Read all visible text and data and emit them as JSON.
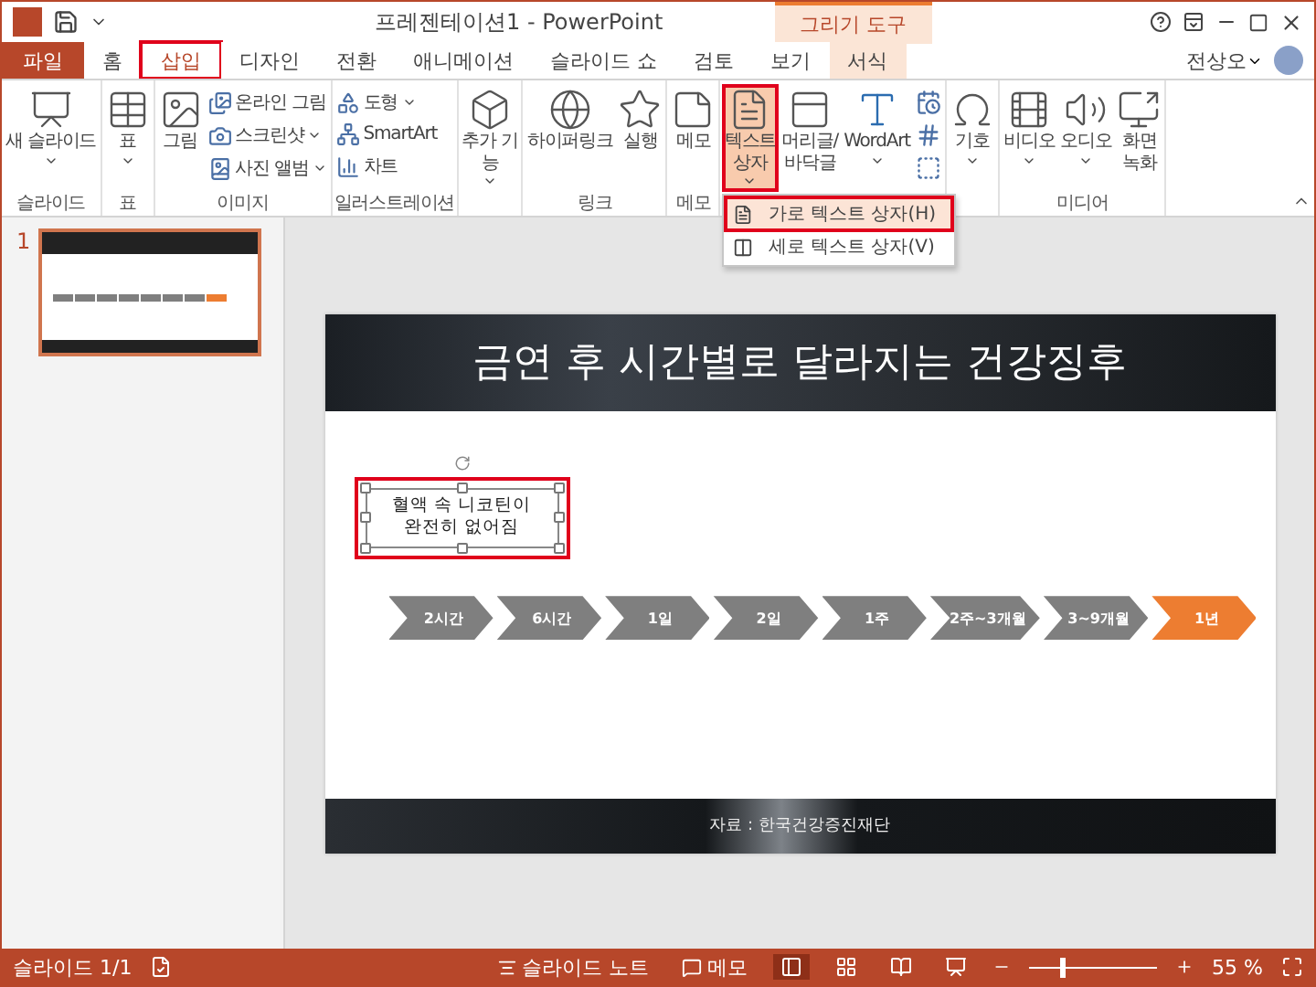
{
  "window": {
    "title": "프레젠테이션1 - PowerPoint",
    "contextual_group": "그리기 도구"
  },
  "tabs": [
    {
      "label": "파일",
      "kind": "file",
      "selected": false,
      "annotated": false
    },
    {
      "label": "홈",
      "kind": "tab",
      "selected": false,
      "annotated": false
    },
    {
      "label": "삽입",
      "kind": "tab",
      "selected": true,
      "annotated": true
    },
    {
      "label": "디자인",
      "kind": "tab",
      "selected": false,
      "annotated": false
    },
    {
      "label": "전환",
      "kind": "tab",
      "selected": false,
      "annotated": false
    },
    {
      "label": "애니메이션",
      "kind": "tab",
      "selected": false,
      "annotated": false
    },
    {
      "label": "슬라이드 쇼",
      "kind": "tab",
      "selected": false,
      "annotated": false
    },
    {
      "label": "검토",
      "kind": "tab",
      "selected": false,
      "annotated": false
    },
    {
      "label": "보기",
      "kind": "tab",
      "selected": false,
      "annotated": false
    },
    {
      "label": "서식",
      "kind": "contextual",
      "selected": false,
      "annotated": false
    }
  ],
  "user": {
    "name": "전상오"
  },
  "ribbon": [
    {
      "label": "슬라이드",
      "items": [
        {
          "kind": "large",
          "lines": [
            "새 슬라이드"
          ],
          "dropdown": true,
          "annotated": false
        }
      ]
    },
    {
      "label": "표",
      "items": [
        {
          "kind": "large",
          "lines": [
            "표"
          ],
          "dropdown": true,
          "annotated": false
        }
      ]
    },
    {
      "label": "이미지",
      "items": [
        {
          "kind": "large",
          "lines": [
            "그림"
          ],
          "dropdown": false,
          "annotated": false
        },
        {
          "kind": "stack",
          "items": [
            {
              "label": "온라인 그림",
              "dropdown": false
            },
            {
              "label": "스크린샷",
              "dropdown": true
            },
            {
              "label": "사진 앨범",
              "dropdown": true
            }
          ]
        }
      ]
    },
    {
      "label": "일러스트레이션",
      "items": [
        {
          "kind": "stack",
          "items": [
            {
              "label": "도형",
              "dropdown": true
            },
            {
              "label": "SmartArt",
              "dropdown": false
            },
            {
              "label": "차트",
              "dropdown": false
            }
          ]
        }
      ]
    },
    {
      "items": [
        {
          "kind": "large",
          "lines": [
            "추가 기",
            "능"
          ],
          "dropdown": true,
          "annotated": false
        }
      ]
    },
    {
      "label": "링크",
      "items": [
        {
          "kind": "large",
          "lines": [
            "하이퍼링크"
          ],
          "dropdown": false,
          "annotated": false
        },
        {
          "kind": "large",
          "lines": [
            "실행"
          ],
          "dropdown": false,
          "annotated": false
        }
      ]
    },
    {
      "label": "메모",
      "items": [
        {
          "kind": "large",
          "lines": [
            "메모"
          ],
          "dropdown": false,
          "annotated": false
        }
      ]
    },
    {
      "items": [
        {
          "kind": "large",
          "lines": [
            "텍스트",
            "상자"
          ],
          "dropdown": true,
          "annotated": true,
          "menu": [
            {
              "label": "가로 텍스트 상자(H)",
              "selected": true,
              "annotated": true
            },
            {
              "label": "세로 텍스트 상자(V)",
              "selected": false,
              "annotated": false
            }
          ]
        },
        {
          "kind": "large",
          "lines": [
            "머리글/",
            "바닥글"
          ],
          "dropdown": false,
          "annotated": false
        },
        {
          "kind": "large",
          "lines": [
            "WordArt"
          ],
          "dropdown": true,
          "annotated": false
        },
        {
          "kind": "icons"
        }
      ]
    },
    {
      "items": [
        {
          "kind": "large",
          "lines": [
            "기호"
          ],
          "dropdown": true,
          "annotated": false
        }
      ]
    },
    {
      "label": "미디어",
      "items": [
        {
          "kind": "large",
          "lines": [
            "비디오"
          ],
          "dropdown": true,
          "annotated": false
        },
        {
          "kind": "large",
          "lines": [
            "오디오"
          ],
          "dropdown": true,
          "annotated": false
        },
        {
          "kind": "large",
          "lines": [
            "화면",
            "녹화"
          ],
          "dropdown": false,
          "annotated": false
        }
      ]
    }
  ],
  "thumbnails": [
    {
      "number": "1",
      "selected": true
    }
  ],
  "slide": {
    "title": "금연 후 시간별로 달라지는 건강징후",
    "text_box": {
      "lines": [
        "혈액 속 니코틴이",
        "완전히 없어짐"
      ],
      "selected": true,
      "annotated": true
    },
    "steps": [
      {
        "label": "2시간",
        "color": "#7f7f7f"
      },
      {
        "label": "6시간",
        "color": "#7f7f7f"
      },
      {
        "label": "1일",
        "color": "#7f7f7f"
      },
      {
        "label": "2일",
        "color": "#7f7f7f"
      },
      {
        "label": "1주",
        "color": "#7f7f7f"
      },
      {
        "label": "2주~3개월",
        "color": "#7f7f7f"
      },
      {
        "label": "3~9개월",
        "color": "#7f7f7f"
      },
      {
        "label": "1년",
        "color": "#ed7d31"
      }
    ],
    "source": "자료 : 한국건강증진재단"
  },
  "status_bar": {
    "slide_count": "슬라이드 1/1",
    "notes": "슬라이드 노트",
    "comments": "메모",
    "views": [
      {
        "selected": true
      },
      {
        "selected": false
      },
      {
        "selected": false
      },
      {
        "selected": false
      }
    ],
    "zoom": {
      "level": 0.25,
      "reading": "55 %"
    }
  }
}
